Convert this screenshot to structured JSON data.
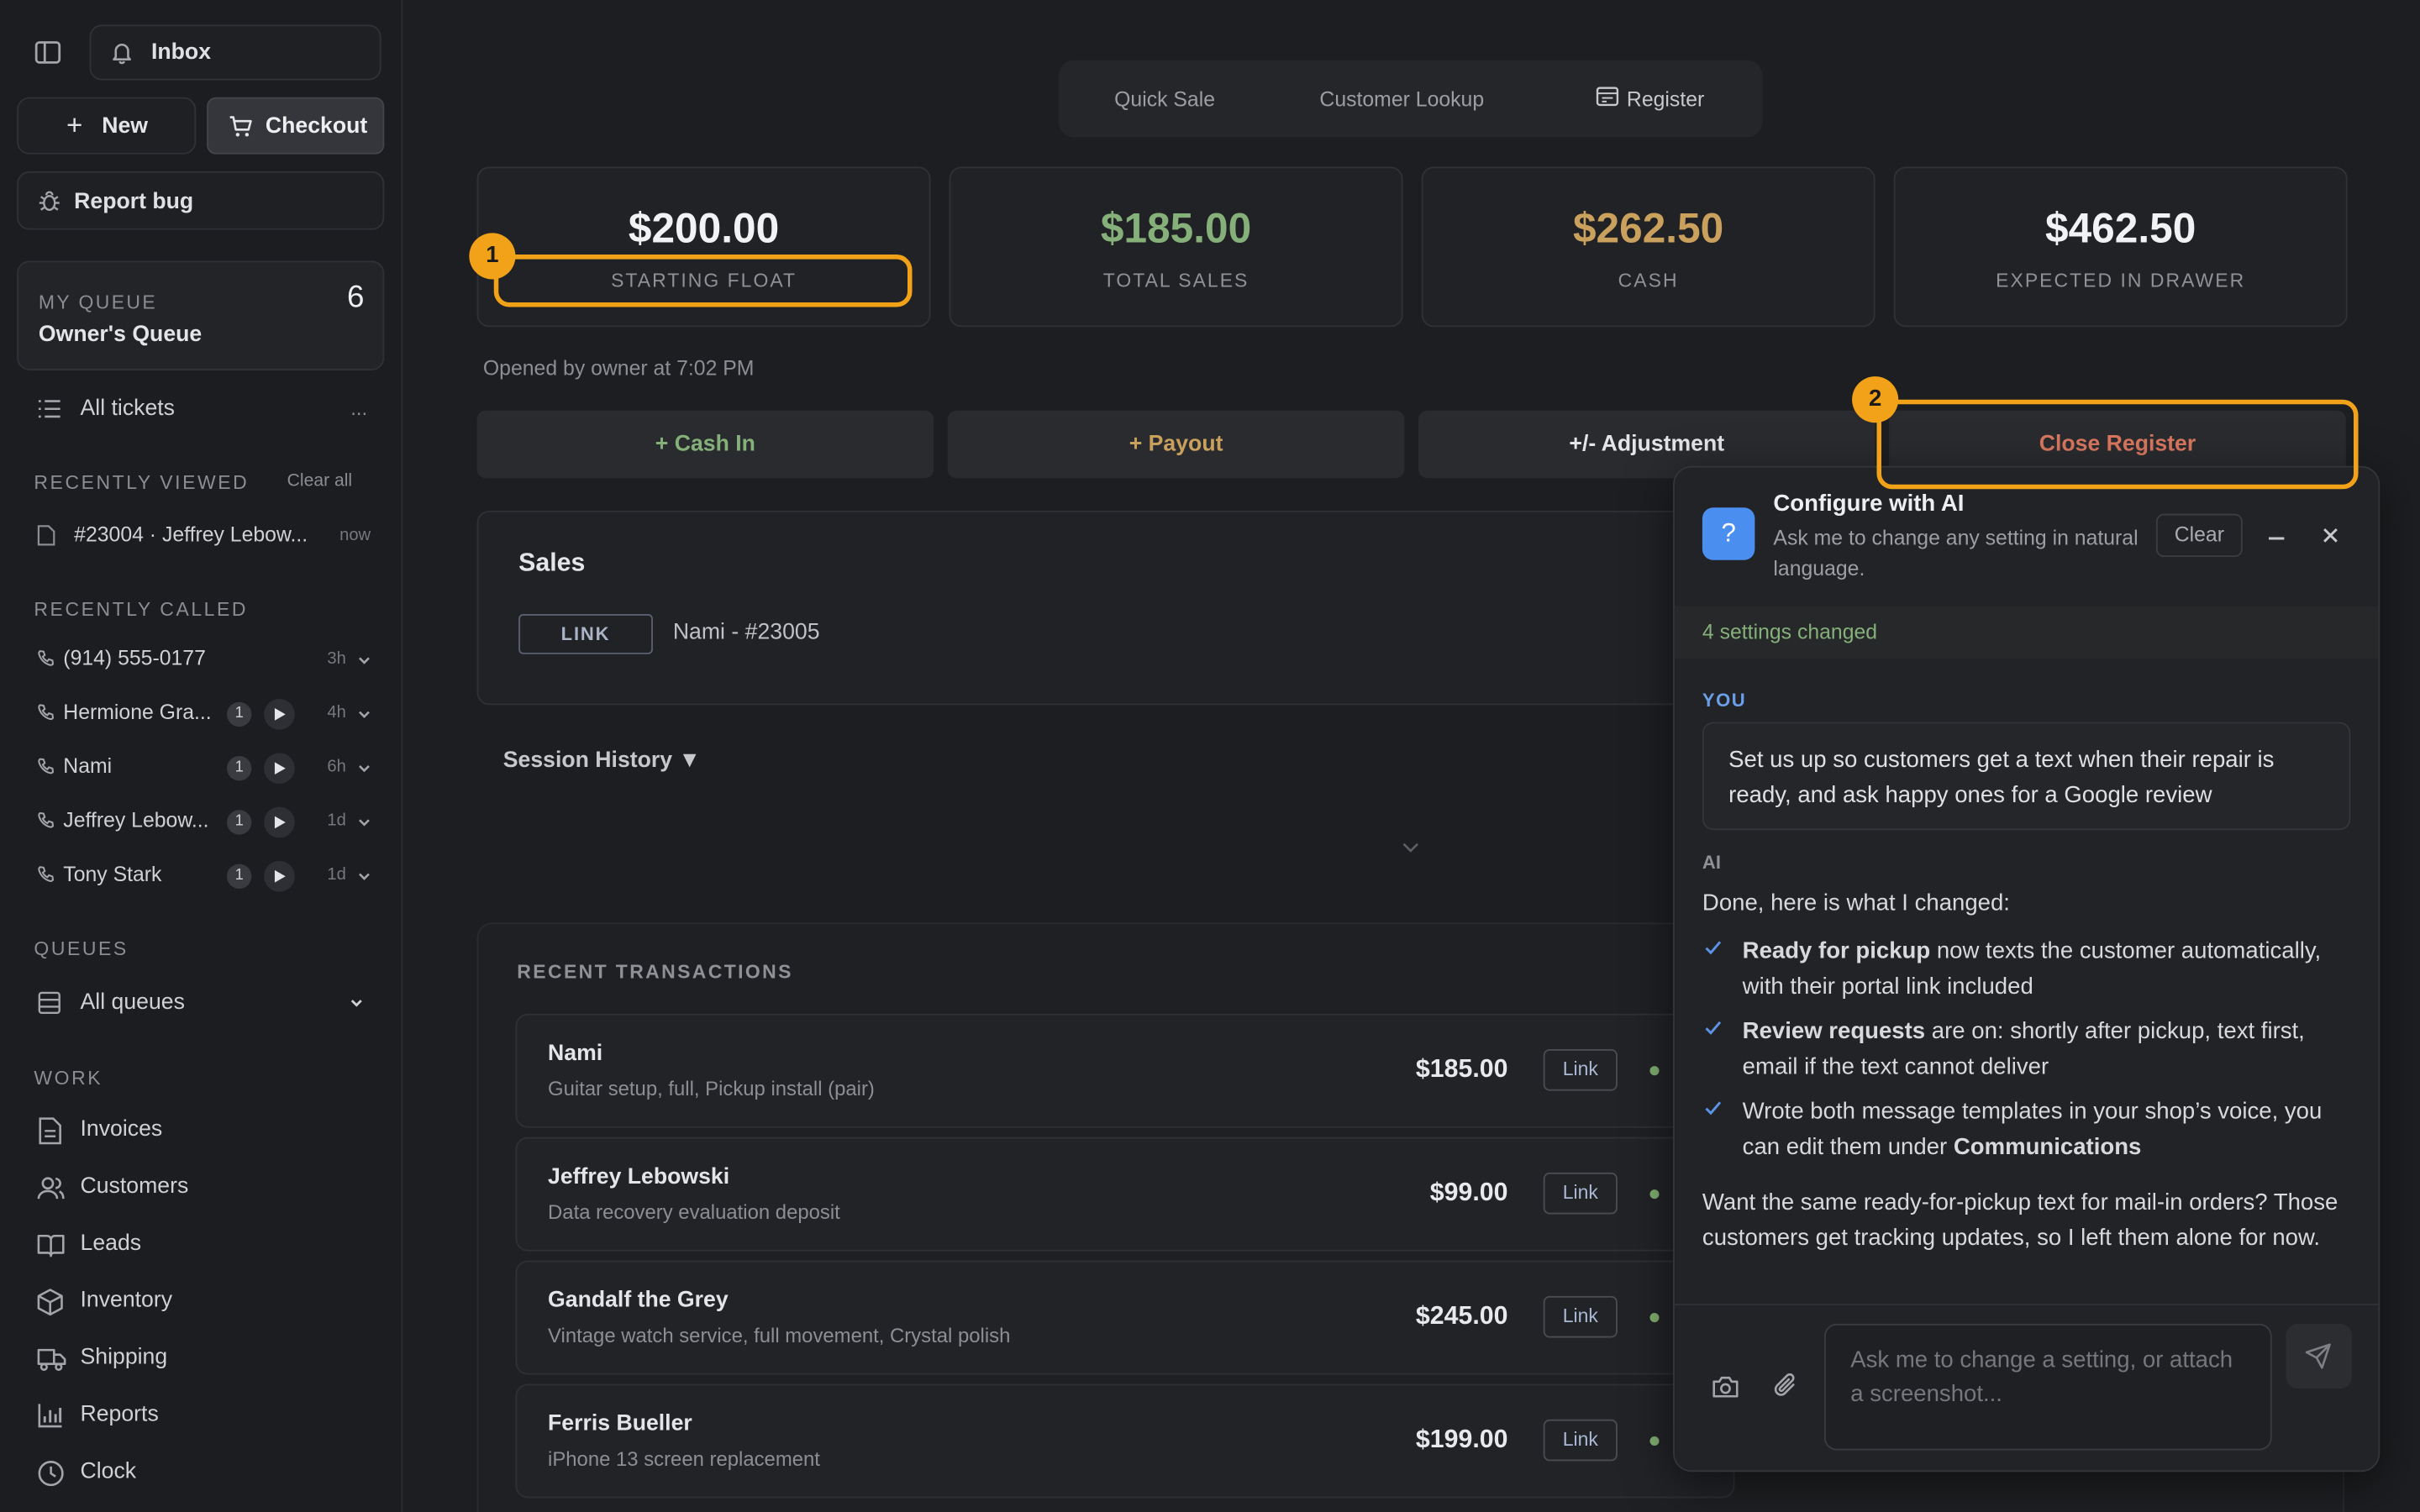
{
  "sidebar": {
    "inbox_label": "Inbox",
    "new_label": "New",
    "checkout_label": "Checkout",
    "report_bug_label": "Report bug",
    "queue": {
      "title": "MY QUEUE",
      "name": "Owner's Queue",
      "count": "6"
    },
    "all_tickets_label": "All tickets",
    "all_tickets_more": "...",
    "recently_viewed": {
      "title": "RECENTLY VIEWED",
      "clear_label": "Clear all",
      "items": [
        {
          "label": "#23004 · Jeffrey Lebow...",
          "time": "now"
        }
      ]
    },
    "recently_called": {
      "title": "RECENTLY CALLED",
      "items": [
        {
          "label": "(914) 555-0177",
          "count": "",
          "time": "3h"
        },
        {
          "label": "Hermione Gra...",
          "count": "1",
          "time": "4h"
        },
        {
          "label": "Nami",
          "count": "1",
          "time": "6h"
        },
        {
          "label": "Jeffrey Lebow...",
          "count": "1",
          "time": "1d"
        },
        {
          "label": "Tony Stark",
          "count": "1",
          "time": "1d"
        }
      ]
    },
    "queues": {
      "title": "QUEUES",
      "all_label": "All queues"
    },
    "work": {
      "title": "WORK",
      "items": [
        {
          "label": "Invoices",
          "icon": "file-icon"
        },
        {
          "label": "Customers",
          "icon": "users-icon"
        },
        {
          "label": "Leads",
          "icon": "book-icon"
        },
        {
          "label": "Inventory",
          "icon": "box-icon"
        },
        {
          "label": "Shipping",
          "icon": "truck-icon"
        },
        {
          "label": "Reports",
          "icon": "bar-chart-icon"
        },
        {
          "label": "Clock",
          "icon": "clock-icon"
        }
      ]
    }
  },
  "tabs": [
    {
      "label": "Quick Sale"
    },
    {
      "label": "Customer Lookup"
    },
    {
      "label": "Register"
    }
  ],
  "stats": [
    {
      "value": "$200.00",
      "caption": "STARTING FLOAT",
      "color": "#f1f2f4"
    },
    {
      "value": "$185.00",
      "caption": "TOTAL SALES",
      "color": "#86b07a"
    },
    {
      "value": "$262.50",
      "caption": "CASH",
      "color": "#c9a15c"
    },
    {
      "value": "$462.50",
      "caption": "EXPECTED IN DRAWER",
      "color": "#f1f2f4"
    }
  ],
  "opened_by": "Opened by owner at 7:02 PM",
  "actions": {
    "cash_in": "+ Cash In",
    "payout": "+ Payout",
    "adjustment": "+/- Adjustment",
    "close_register": "Close Register"
  },
  "sales": {
    "title": "Sales",
    "link_badge": "LINK",
    "link_text": "Nami - #23005"
  },
  "session_history_label": "Session History ▼",
  "recent": {
    "title": "RECENT TRANSACTIONS",
    "link_label": "Link",
    "rows": [
      {
        "name": "Nami",
        "desc": "Guitar setup, full, Pickup install (pair)",
        "amount": "$185.00"
      },
      {
        "name": "Jeffrey Lebowski",
        "desc": "Data recovery evaluation deposit",
        "amount": "$99.00"
      },
      {
        "name": "Gandalf the Grey",
        "desc": "Vintage watch service, full movement, Crystal polish",
        "amount": "$245.00"
      },
      {
        "name": "Ferris Bueller",
        "desc": "iPhone 13 screen replacement",
        "amount": "$199.00"
      }
    ]
  },
  "ai": {
    "title": "Configure with AI",
    "subtitle": "Ask me to change any setting in natural language.",
    "clear_label": "Clear",
    "changed_banner": "4 settings changed",
    "you_label": "YOU",
    "user_message": "Set us up so customers get a text when their repair is ready, and ask happy ones for a Google review",
    "ai_label": "AI",
    "intro": "Done, here is what I changed:",
    "bullets": [
      {
        "bold": "Ready for pickup",
        "rest": " now texts the customer automatically, with their portal link included",
        "tail_bold": ""
      },
      {
        "bold": "Review requests",
        "rest": " are on: shortly after pickup, text first, email if the text cannot deliver",
        "tail_bold": ""
      },
      {
        "bold": "",
        "rest": "Wrote both message templates in your shop’s voice, you can edit them under ",
        "tail_bold": "Communications"
      }
    ],
    "followup": "Want the same ready-for-pickup text for mail-in orders? Those customers get tracking updates, so I left them alone for now.",
    "input_placeholder": "Ask me to change a setting, or attach a screenshot..."
  },
  "annotations": [
    {
      "label": "1"
    },
    {
      "label": "2"
    }
  ],
  "colors": {
    "accent": "#f2a218",
    "green": "#86b07a",
    "gold": "#c9a15c",
    "red": "#d9775f",
    "ai_blue": "#4a8ef0"
  }
}
